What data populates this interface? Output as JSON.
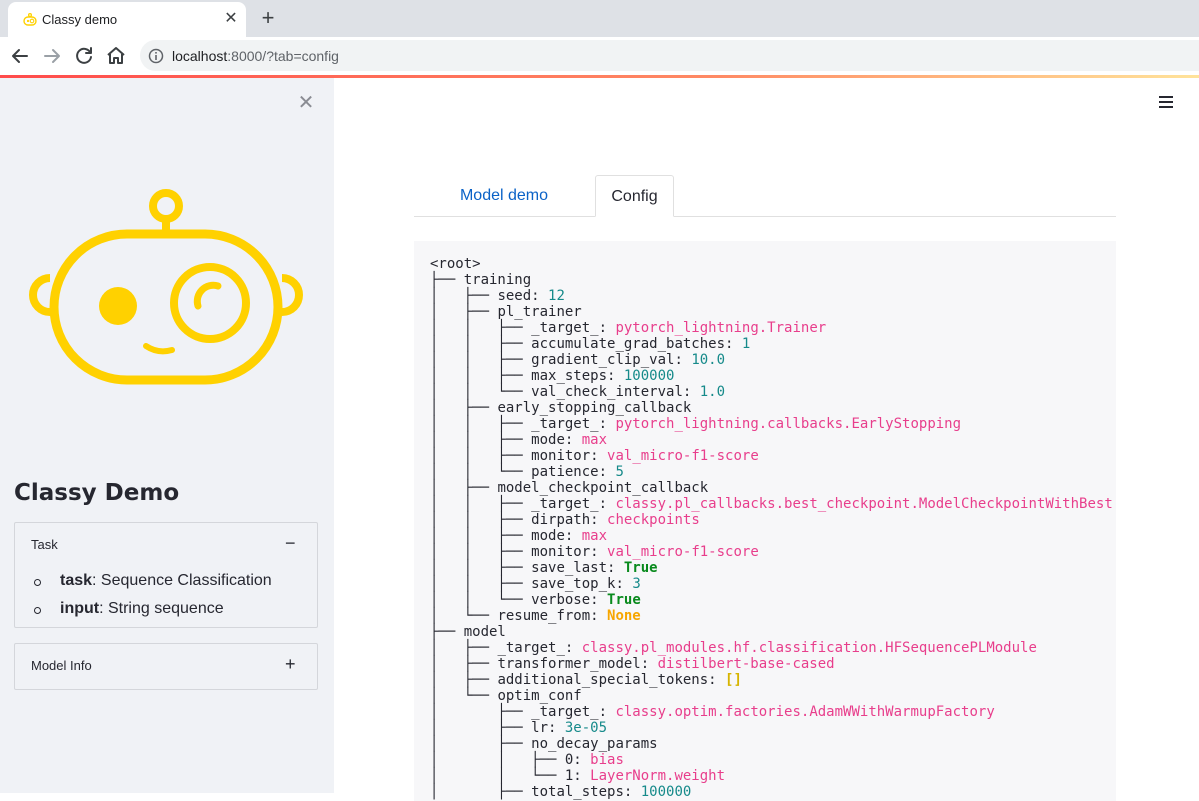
{
  "browser": {
    "tab_title": "Classy demo",
    "tab_close": "✕",
    "new_tab": "+",
    "url_host": "localhost",
    "url_rest": ":8000/?tab=config"
  },
  "sidebar": {
    "close_glyph": "✕",
    "title": "Classy Demo",
    "expanders": [
      {
        "label": "Task",
        "toggle": "−",
        "items": [
          {
            "key": "task",
            "value": ": Sequence Classification"
          },
          {
            "key": "input",
            "value": ": String sequence"
          }
        ]
      },
      {
        "label": "Model Info",
        "toggle": "+"
      }
    ]
  },
  "main": {
    "tabs": [
      {
        "label": "Model demo",
        "active": false
      },
      {
        "label": "Config",
        "active": true
      }
    ]
  },
  "config_tree": [
    {
      "prefix": "<root>",
      "key": "",
      "sep": "",
      "value": "",
      "type": ""
    },
    {
      "prefix": "├── ",
      "key": "training",
      "sep": "",
      "value": "",
      "type": ""
    },
    {
      "prefix": "│   ├── ",
      "key": "seed",
      "sep": ": ",
      "value": "12",
      "type": "num"
    },
    {
      "prefix": "│   ├── ",
      "key": "pl_trainer",
      "sep": "",
      "value": "",
      "type": ""
    },
    {
      "prefix": "│   │   ├── ",
      "key": "_target_",
      "sep": ": ",
      "value": "pytorch_lightning.Trainer",
      "type": "str"
    },
    {
      "prefix": "│   │   ├── ",
      "key": "accumulate_grad_batches",
      "sep": ": ",
      "value": "1",
      "type": "num"
    },
    {
      "prefix": "│   │   ├── ",
      "key": "gradient_clip_val",
      "sep": ": ",
      "value": "10.0",
      "type": "num"
    },
    {
      "prefix": "│   │   ├── ",
      "key": "max_steps",
      "sep": ": ",
      "value": "100000",
      "type": "num"
    },
    {
      "prefix": "│   │   └── ",
      "key": "val_check_interval",
      "sep": ": ",
      "value": "1.0",
      "type": "num"
    },
    {
      "prefix": "│   ├── ",
      "key": "early_stopping_callback",
      "sep": "",
      "value": "",
      "type": ""
    },
    {
      "prefix": "│   │   ├── ",
      "key": "_target_",
      "sep": ": ",
      "value": "pytorch_lightning.callbacks.EarlyStopping",
      "type": "str"
    },
    {
      "prefix": "│   │   ├── ",
      "key": "mode",
      "sep": ": ",
      "value": "max",
      "type": "str"
    },
    {
      "prefix": "│   │   ├── ",
      "key": "monitor",
      "sep": ": ",
      "value": "val_micro-f1-score",
      "type": "str"
    },
    {
      "prefix": "│   │   └── ",
      "key": "patience",
      "sep": ": ",
      "value": "5",
      "type": "num"
    },
    {
      "prefix": "│   ├── ",
      "key": "model_checkpoint_callback",
      "sep": "",
      "value": "",
      "type": ""
    },
    {
      "prefix": "│   │   ├── ",
      "key": "_target_",
      "sep": ": ",
      "value": "classy.pl_callbacks.best_checkpoint.ModelCheckpointWithBest",
      "type": "str"
    },
    {
      "prefix": "│   │   ├── ",
      "key": "dirpath",
      "sep": ": ",
      "value": "checkpoints",
      "type": "str"
    },
    {
      "prefix": "│   │   ├── ",
      "key": "mode",
      "sep": ": ",
      "value": "max",
      "type": "str"
    },
    {
      "prefix": "│   │   ├── ",
      "key": "monitor",
      "sep": ": ",
      "value": "val_micro-f1-score",
      "type": "str"
    },
    {
      "prefix": "│   │   ├── ",
      "key": "save_last",
      "sep": ": ",
      "value": "True",
      "type": "bool"
    },
    {
      "prefix": "│   │   ├── ",
      "key": "save_top_k",
      "sep": ": ",
      "value": "3",
      "type": "num"
    },
    {
      "prefix": "│   │   └── ",
      "key": "verbose",
      "sep": ": ",
      "value": "True",
      "type": "bool"
    },
    {
      "prefix": "│   └── ",
      "key": "resume_from",
      "sep": ": ",
      "value": "None",
      "type": "none"
    },
    {
      "prefix": "├── ",
      "key": "model",
      "sep": "",
      "value": "",
      "type": ""
    },
    {
      "prefix": "│   ├── ",
      "key": "_target_",
      "sep": ": ",
      "value": "classy.pl_modules.hf.classification.HFSequencePLModule",
      "type": "str"
    },
    {
      "prefix": "│   ├── ",
      "key": "transformer_model",
      "sep": ": ",
      "value": "distilbert-base-cased",
      "type": "str"
    },
    {
      "prefix": "│   ├── ",
      "key": "additional_special_tokens",
      "sep": ": ",
      "value": "[]",
      "type": "list"
    },
    {
      "prefix": "│   └── ",
      "key": "optim_conf",
      "sep": "",
      "value": "",
      "type": ""
    },
    {
      "prefix": "│       ├── ",
      "key": "_target_",
      "sep": ": ",
      "value": "classy.optim.factories.AdamWWithWarmupFactory",
      "type": "str"
    },
    {
      "prefix": "│       ├── ",
      "key": "lr",
      "sep": ": ",
      "value": "3e-05",
      "type": "num"
    },
    {
      "prefix": "│       ├── ",
      "key": "no_decay_params",
      "sep": "",
      "value": "",
      "type": ""
    },
    {
      "prefix": "│       │   ├── ",
      "key": "0",
      "sep": ": ",
      "value": "bias",
      "type": "str"
    },
    {
      "prefix": "│       │   └── ",
      "key": "1",
      "sep": ": ",
      "value": "LayerNorm.weight",
      "type": "str"
    },
    {
      "prefix": "│       ├── ",
      "key": "total_steps",
      "sep": ": ",
      "value": "100000",
      "type": "num"
    }
  ],
  "colors": {
    "accent_yellow": "#ffd100",
    "link_blue": "#0a62c7",
    "string_pink": "#e83e8c",
    "number_teal": "#168a8a",
    "bool_green": "#098a1d",
    "none_orange": "#f7a600"
  },
  "icons": {
    "back": "back-arrow-icon",
    "forward": "forward-arrow-icon",
    "reload": "reload-icon",
    "home": "home-icon",
    "info": "info-icon",
    "menu": "hamburger-menu-icon",
    "logo": "robot-logo"
  }
}
